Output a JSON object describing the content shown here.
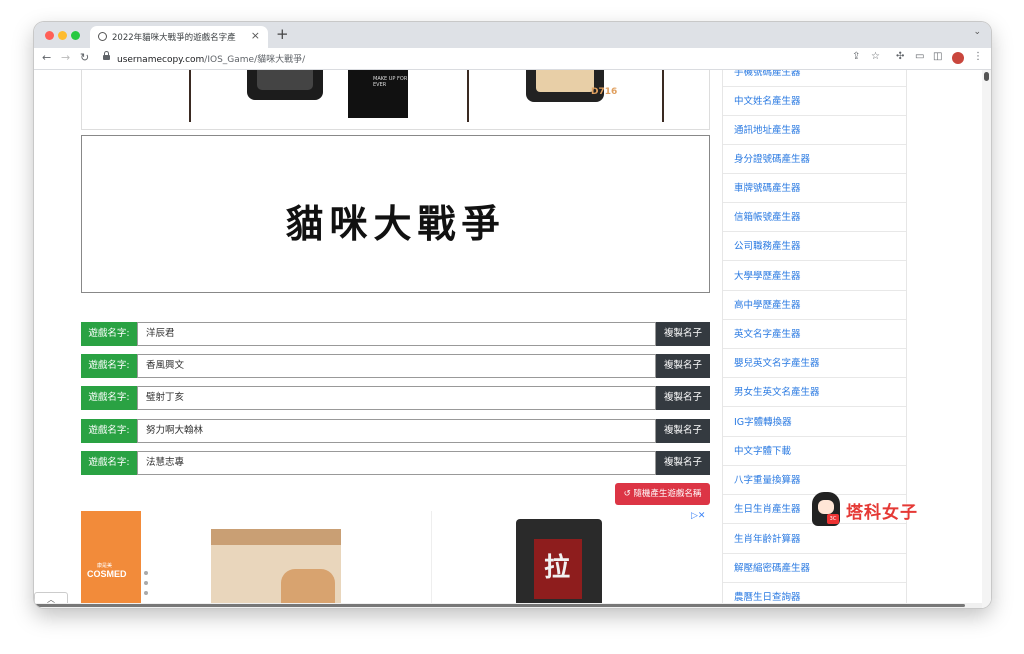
{
  "browser": {
    "tab_title": "2022年貓咪大戰爭的遊戲名字產",
    "url_domain": "usernamecopy.com",
    "url_path": "/IOS_Game/貓咪大戰爭/",
    "new_tab": "+",
    "tab_close": "×"
  },
  "top_ad": {
    "product_code": "D716",
    "pouch_label": "MAKE UP FOR EVER"
  },
  "game_title": "貓咪大戰爭",
  "name_rows": [
    {
      "label": "遊戲名字:",
      "value": "洋辰君",
      "copy": "複製名子"
    },
    {
      "label": "遊戲名字:",
      "value": "香風興文",
      "copy": "複製名子"
    },
    {
      "label": "遊戲名字:",
      "value": "璧射丁亥",
      "copy": "複製名子"
    },
    {
      "label": "遊戲名字:",
      "value": "努力啊大翰林",
      "copy": "複製名子"
    },
    {
      "label": "遊戲名字:",
      "value": "法慧志專",
      "copy": "複製名子"
    }
  ],
  "random_button": "↺ 隨機產生遊戲名稱",
  "bottom_ad": {
    "brand": "COSMED",
    "brand_cn": "康是美",
    "noodle_char": "拉",
    "close": "▷✕"
  },
  "sidebar": {
    "items": [
      "手機號碼產生器",
      "中文姓名產生器",
      "通訊地址產生器",
      "身分證號碼產生器",
      "車牌號碼產生器",
      "信箱帳號產生器",
      "公司職務產生器",
      "大學學歷產生器",
      "高中學歷產生器",
      "英文名字產生器",
      "嬰兒英文名字產生器",
      "男女生英文名產生器",
      "IG字體轉換器",
      "中文字體下載",
      "八字重量換算器",
      "生日生肖產生器",
      "生肖年齡計算器",
      "解壓縮密碼產生器",
      "農曆生日查詢器"
    ]
  },
  "watermark": {
    "text": "塔科女子",
    "badge": "3C"
  },
  "scroll_up": "︿"
}
